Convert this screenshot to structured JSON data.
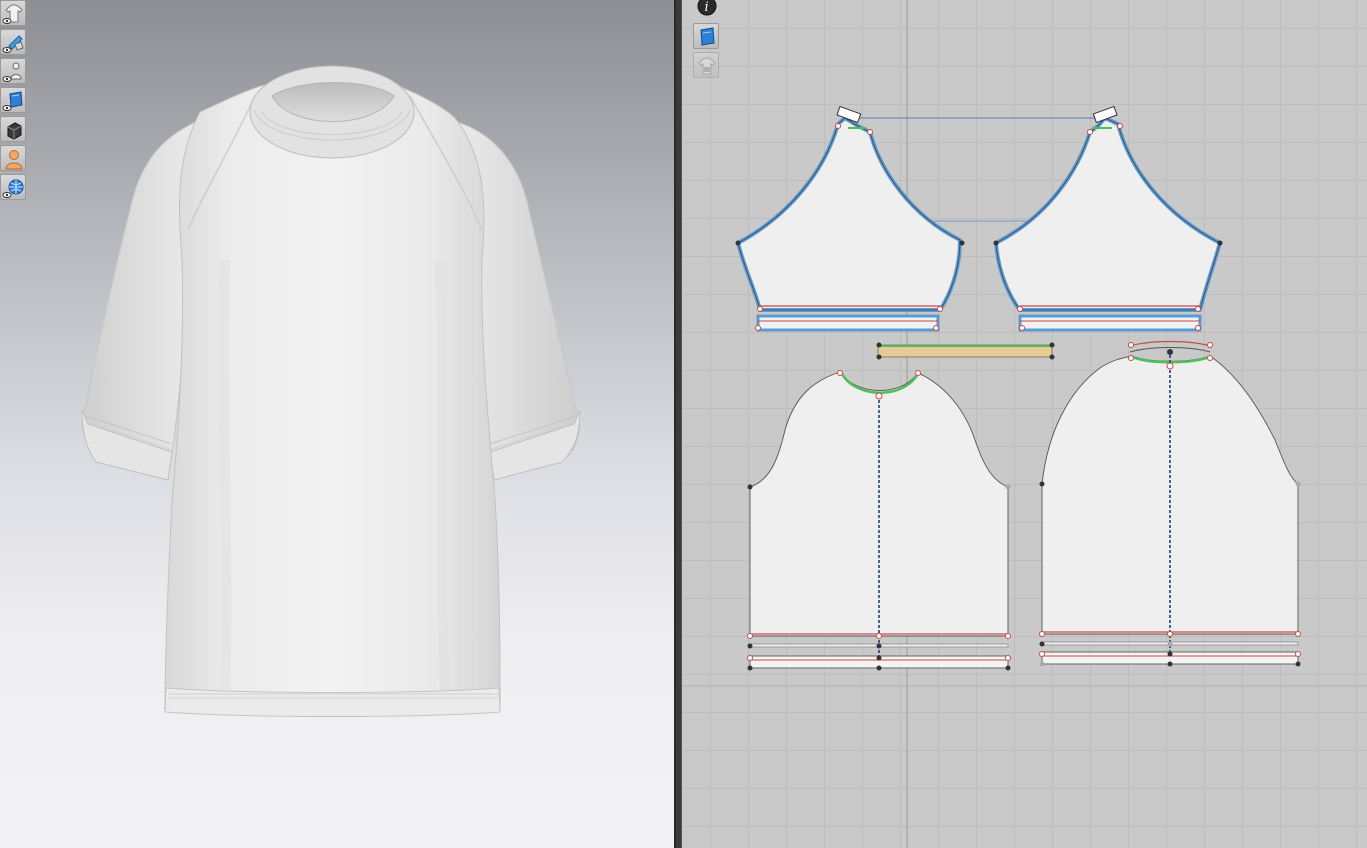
{
  "app": {
    "accent": "#2f7fd8",
    "panels": [
      "3d-avatar-view",
      "2d-pattern-view"
    ]
  },
  "left_toolbar": {
    "items": [
      {
        "id": "show-garment",
        "icon": "shirt-eye-icon"
      },
      {
        "id": "show-avatar-measure",
        "icon": "brush-eye-icon"
      },
      {
        "id": "show-avatar",
        "icon": "avatar-eye-icon"
      },
      {
        "id": "show-fabric",
        "icon": "fabric-eye-icon"
      },
      {
        "id": "show-shadow",
        "icon": "cube-icon"
      },
      {
        "id": "avatar-skin",
        "icon": "person-icon"
      },
      {
        "id": "environment",
        "icon": "globe-eye-icon"
      }
    ]
  },
  "right_toolbar": {
    "items": [
      {
        "id": "info",
        "icon": "info-icon"
      },
      {
        "id": "pattern-fabric",
        "icon": "fabric-card-icon"
      },
      {
        "id": "lock-pattern",
        "icon": "shirt-lock-icon"
      }
    ]
  },
  "colors": {
    "stitch_blue": "#5b9bd5",
    "seam_red": "#c94a4a",
    "seam_green": "#4bbf5a",
    "binding_tan": "#e8c99a",
    "pattern_fill": "#eeeeee"
  }
}
